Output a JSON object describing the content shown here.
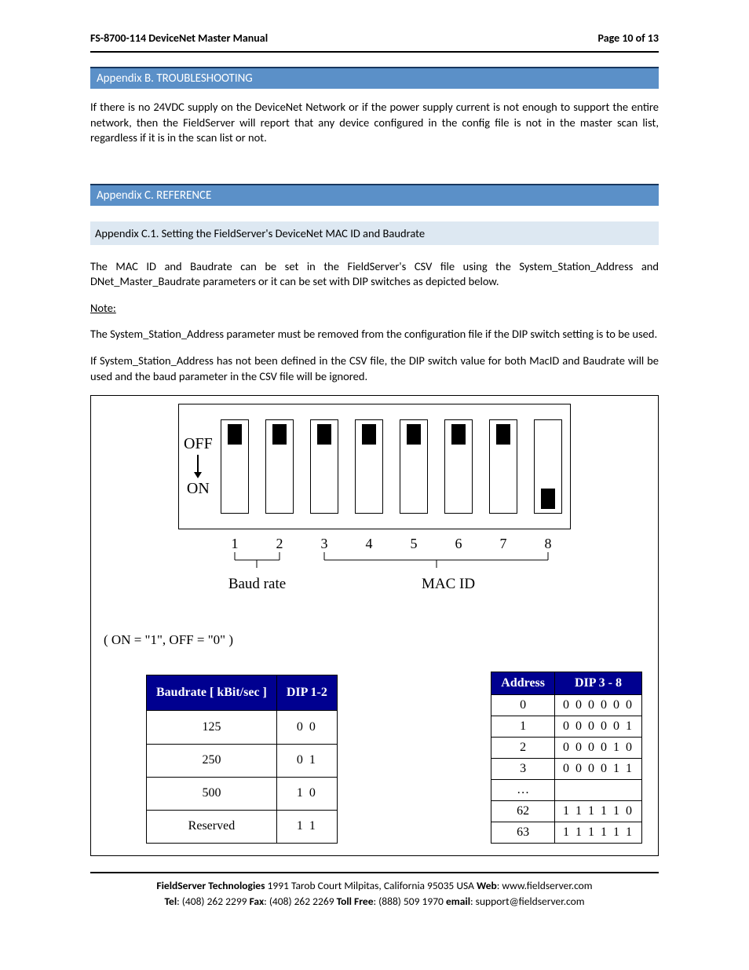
{
  "header": {
    "title": "FS-8700-114 DeviceNet Master Manual",
    "page": "Page 10 of 13"
  },
  "appendixB": {
    "title": "Appendix B. TROUBLESHOOTING",
    "body": "If there is no 24VDC supply on the DeviceNet Network or if the power supply current is not enough to support the entire network, then the FieldServer will report that any device configured in the config file is not in the master scan list, regardless if it is in the scan list or not."
  },
  "appendixC": {
    "title": "Appendix C. REFERENCE",
    "sub1_title": "Appendix C.1. Setting the FieldServer's DeviceNet MAC ID and Baudrate",
    "para1": "The MAC ID and Baudrate can be set in the FieldServer's CSV file using the System_Station_Address and DNet_Master_Baudrate parameters or it can be set with DIP switches as depicted below.",
    "note_label": "Note:",
    "note_body": "The System_Station_Address parameter must be removed from the configuration file if the DIP switch setting is to be used.",
    "para2": "If System_Station_Address has not been defined in the CSV file, the DIP switch value for both MacID and Baudrate will be used and the baud parameter in the CSV file will be ignored."
  },
  "dip": {
    "off_label": "OFF",
    "on_label": "ON",
    "switch_states": [
      "off",
      "off",
      "off",
      "off",
      "off",
      "off",
      "off",
      "on"
    ],
    "numbers": [
      "1",
      "2",
      "3",
      "4",
      "5",
      "6",
      "7",
      "8"
    ],
    "group_baud": "Baud rate",
    "group_mac": "MAC ID",
    "legend": "( ON = \"1\", OFF = \"0\" )"
  },
  "baud_table": {
    "h1": "Baudrate [ kBit/sec ]",
    "h2": "DIP 1-2",
    "rows": [
      {
        "b": "125",
        "d": "0 0"
      },
      {
        "b": "250",
        "d": "0 1"
      },
      {
        "b": "500",
        "d": "1 0"
      },
      {
        "b": "Reserved",
        "d": "1 1"
      }
    ]
  },
  "addr_table": {
    "h1": "Address",
    "h2": "DIP 3 - 8",
    "rows": [
      {
        "a": "0",
        "d": "0 0 0 0 0 0"
      },
      {
        "a": "1",
        "d": "0 0 0 0 0 1"
      },
      {
        "a": "2",
        "d": "0 0 0 0 1 0"
      },
      {
        "a": "3",
        "d": "0 0 0 0 1 1"
      },
      {
        "a": "…",
        "d": ""
      },
      {
        "a": "62",
        "d": "1 1 1 1 1 0"
      },
      {
        "a": "63",
        "d": "1 1 1 1 1 1"
      }
    ]
  },
  "footer": {
    "company": "FieldServer Technologies",
    "address": " 1991 Tarob Court Milpitas, California 95035 USA   ",
    "web_label": "Web",
    "web": ": www.fieldserver.com",
    "tel_label": "Tel",
    "tel": ": (408) 262 2299   ",
    "fax_label": "Fax",
    "fax": ": (408) 262 2269   ",
    "tollfree_label": "Toll Free",
    "tollfree": ": (888) 509 1970   ",
    "email_label": "email",
    "email": ": support@fieldserver.com"
  }
}
